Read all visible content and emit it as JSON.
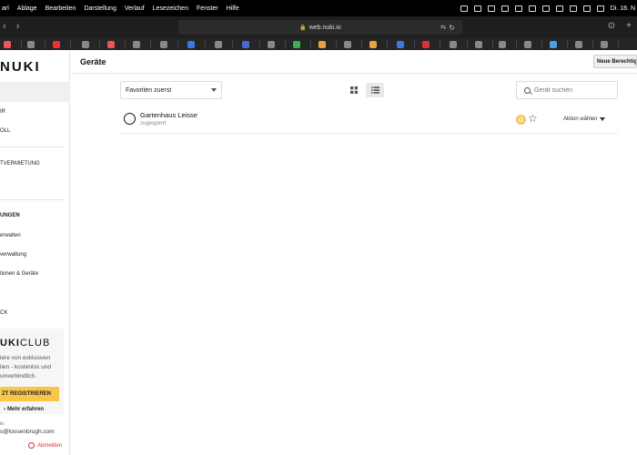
{
  "menubar": {
    "items": [
      "arl",
      "Ablage",
      "Bearbeiten",
      "Darstellung",
      "Verlauf",
      "Lesezeichen",
      "Fenster",
      "Hilfe"
    ],
    "clock": "Di. 18. N"
  },
  "browser": {
    "url": "web.nuki.io"
  },
  "favorites_colors": [
    "#e55",
    "#888",
    "#e33",
    "#888",
    "#e55",
    "#888",
    "#888",
    "#3a7ae0",
    "#888",
    "#4a6ad0",
    "#888",
    "#35b34a",
    "#e8a33a",
    "#888",
    "#e8a33a",
    "#3a7ae0",
    "#d33",
    "#888",
    "#888",
    "#888",
    "#888",
    "#4aa0e0",
    "#888",
    "#888"
  ],
  "sidebar": {
    "logo": "NUKI",
    "items": [
      {
        "label": "IR"
      },
      {
        "label": "OLL"
      },
      {
        "label": "TVERMIETUNG"
      },
      {
        "label": "UNGEN"
      },
      {
        "label": "erwalten"
      },
      {
        "label": "verwaltung"
      },
      {
        "label": "tionen & Geräte"
      },
      {
        "label": "CK"
      }
    ],
    "club": {
      "title_bold": "UKI",
      "title_rest": "CLUB",
      "text": "iere von exklusiven ilen - kostenlos und unverbindlich.",
      "button": "ZT REGISTRIEREN",
      "more": "Mehr erfahren"
    },
    "user": {
      "label": "ils",
      "email": "s@loosenbrugh.com",
      "logout": "Abmelden"
    }
  },
  "main": {
    "title": "Geräte",
    "new_permission": "Neue Berechtig",
    "sort": "Favoriten zuerst",
    "search_placeholder": "Gerät suchen",
    "devices": [
      {
        "name": "Gartenhaus Leisse",
        "status": "zugesperrt",
        "action": "Aktion wählen"
      }
    ]
  }
}
